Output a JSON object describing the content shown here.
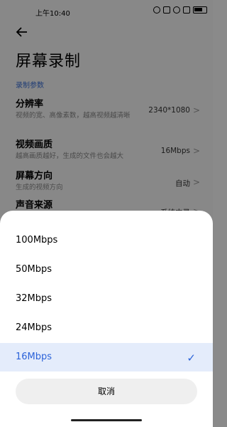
{
  "status_bar": {
    "time": "上午10:40"
  },
  "page": {
    "title": "屏幕录制",
    "section_label": "录制参数",
    "settings": [
      {
        "name": "分辨率",
        "desc": "视频的宽、高像素数，越高视频越清晰",
        "value": "2340*1080"
      },
      {
        "name": "视频画质",
        "desc": "越高画质越好，生成的文件也会越大",
        "value": "16Mbps"
      },
      {
        "name": "屏幕方向",
        "desc": "生成的视频方向",
        "value": "自动"
      },
      {
        "name": "声音来源",
        "desc": "",
        "value": "系统内录"
      }
    ]
  },
  "sheet": {
    "options": [
      "100Mbps",
      "50Mbps",
      "32Mbps",
      "24Mbps",
      "16Mbps"
    ],
    "selected": "16Mbps",
    "cancel_label": "取消"
  },
  "colors": {
    "accent": "#2c63d9",
    "selected_bg": "#e4ecfb"
  }
}
